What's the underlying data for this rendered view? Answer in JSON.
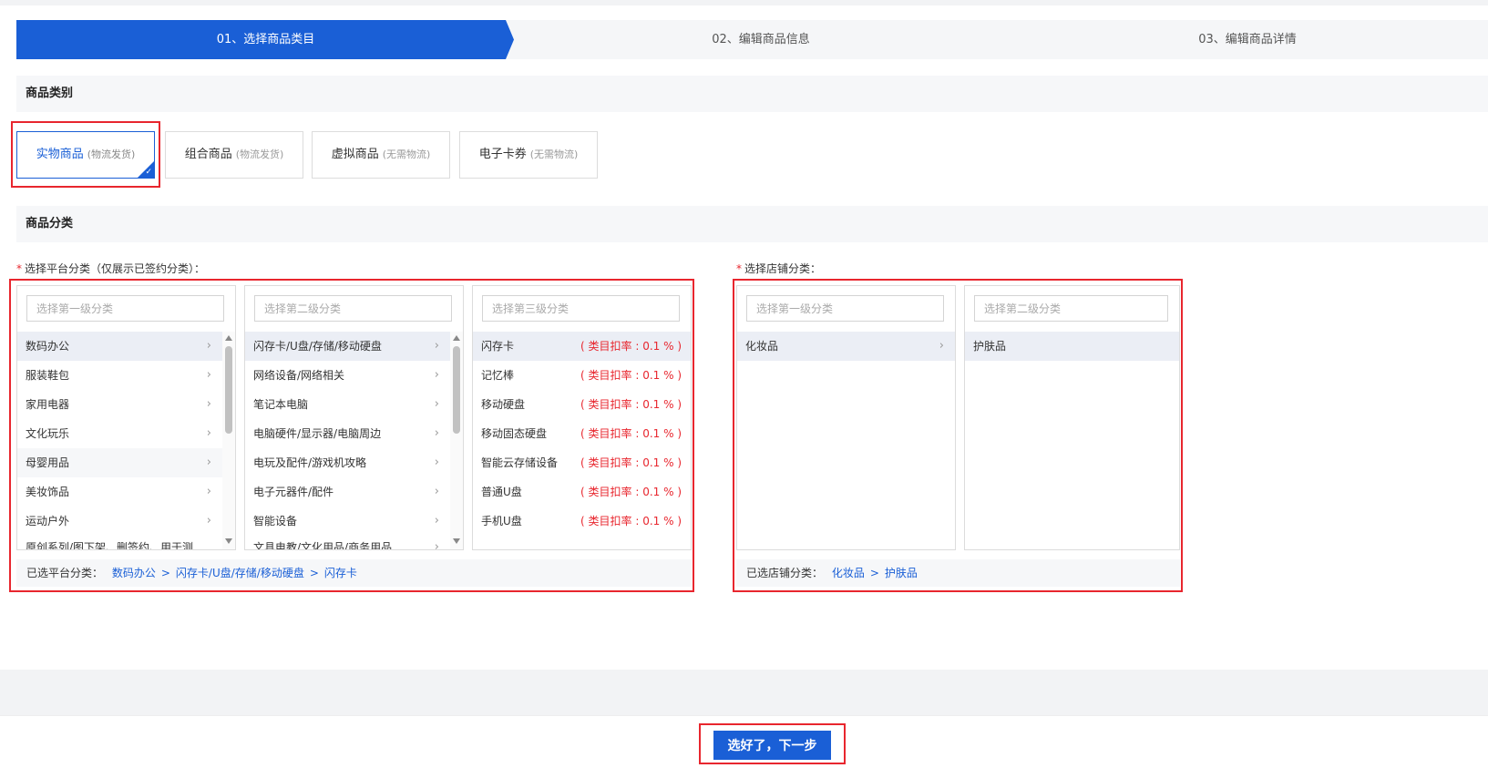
{
  "steps": [
    {
      "label": "01、选择商品类目"
    },
    {
      "label": "02、编辑商品信息"
    },
    {
      "label": "03、编辑商品详情"
    }
  ],
  "product_type_section": {
    "title": "商品类别"
  },
  "product_types": [
    {
      "name": "实物商品",
      "note": "(物流发货)",
      "selected": true
    },
    {
      "name": "组合商品",
      "note": "(物流发货)",
      "selected": false
    },
    {
      "name": "虚拟商品",
      "note": "(无需物流)",
      "selected": false
    },
    {
      "name": "电子卡券",
      "note": "(无需物流)",
      "selected": false
    }
  ],
  "category_section": {
    "title": "商品分类"
  },
  "platform": {
    "label": "选择平台分类（仅展示已签约分类）：",
    "level1": {
      "placeholder": "选择第一级分类",
      "items": [
        "数码办公",
        "服装鞋包",
        "家用电器",
        "文化玩乐",
        "母婴用品",
        "美妆饰品",
        "运动户外",
        "原创系列/图下架、删签约、用于测"
      ]
    },
    "level2": {
      "placeholder": "选择第二级分类",
      "items": [
        "闪存卡/U盘/存储/移动硬盘",
        "网络设备/网络相关",
        "笔记本电脑",
        "电脑硬件/显示器/电脑周边",
        "电玩及配件/游戏机攻略",
        "电子元器件/配件",
        "智能设备",
        "文具电教/文化用品/商务用品"
      ]
    },
    "level3": {
      "placeholder": "选择第三级分类",
      "items": [
        {
          "name": "闪存卡",
          "rate": "( 类目扣率 : 0.1 % )"
        },
        {
          "name": "记忆棒",
          "rate": "( 类目扣率 : 0.1 % )"
        },
        {
          "name": "移动硬盘",
          "rate": "( 类目扣率 : 0.1 % )"
        },
        {
          "name": "移动固态硬盘",
          "rate": "( 类目扣率 : 0.1 % )"
        },
        {
          "name": "智能云存储设备",
          "rate": "( 类目扣率 : 0.1 % )"
        },
        {
          "name": "普通U盘",
          "rate": "( 类目扣率 : 0.1 % )"
        },
        {
          "name": "手机U盘",
          "rate": "( 类目扣率 : 0.1 % )"
        }
      ]
    },
    "selected_label": "已选平台分类：",
    "selected_path": [
      "数码办公",
      "闪存卡/U盘/存储/移动硬盘",
      "闪存卡"
    ],
    "separator": ">"
  },
  "store": {
    "label": "选择店铺分类：",
    "level1": {
      "placeholder": "选择第一级分类",
      "items": [
        "化妆品"
      ]
    },
    "level2": {
      "placeholder": "选择第二级分类",
      "items": [
        "护肤品"
      ]
    },
    "selected_label": "已选店铺分类：",
    "selected_path": [
      "化妆品",
      "护肤品"
    ],
    "separator": ">"
  },
  "next_button": {
    "label": "选好了，下一步"
  },
  "icons": {
    "chevron": "chevron-right-icon",
    "check": "check-icon"
  },
  "colors": {
    "primary": "#1a5fd6",
    "highlight": "#e8262e"
  }
}
